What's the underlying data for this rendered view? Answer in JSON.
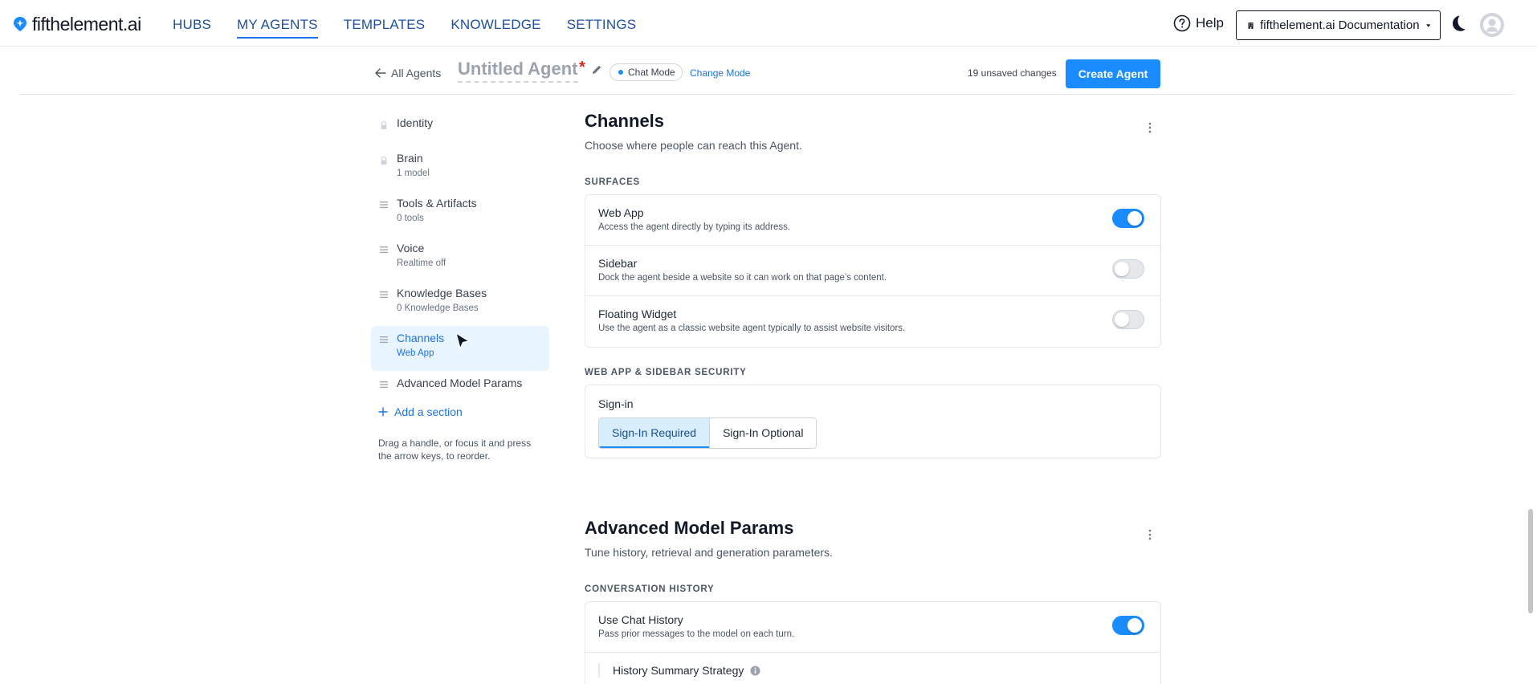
{
  "nav": {
    "brand": "fifthelement.ai",
    "links": [
      "HUBS",
      "MY AGENTS",
      "TEMPLATES",
      "KNOWLEDGE",
      "SETTINGS"
    ],
    "active_link": "MY AGENTS",
    "help": "Help",
    "org": "fifthelement.ai Documentation"
  },
  "header": {
    "back": "All Agents",
    "agent_name": "Untitled Agent",
    "required_marker": "*",
    "mode": "Chat Mode",
    "change_mode": "Change Mode",
    "unsaved": "19 unsaved changes",
    "create": "Create Agent"
  },
  "sections": {
    "items": [
      {
        "label": "Identity",
        "sub": "",
        "locked": true
      },
      {
        "label": "Brain",
        "sub": "1 model",
        "locked": true
      },
      {
        "label": "Tools & Artifacts",
        "sub": "0 tools",
        "locked": false
      },
      {
        "label": "Voice",
        "sub": "Realtime off",
        "locked": false
      },
      {
        "label": "Knowledge Bases",
        "sub": "0 Knowledge Bases",
        "locked": false
      },
      {
        "label": "Channels",
        "sub": "Web App",
        "locked": false,
        "active": true
      },
      {
        "label": "Advanced Model Params",
        "sub": "",
        "locked": false
      }
    ],
    "add": "Add a section",
    "hint": "Drag a handle, or focus it and press the arrow keys, to reorder."
  },
  "channels": {
    "title": "Channels",
    "desc": "Choose where people can reach this Agent.",
    "surfaces_label": "SURFACES",
    "surfaces": [
      {
        "title": "Web App",
        "desc": "Access the agent directly by typing its address.",
        "on": true
      },
      {
        "title": "Sidebar",
        "desc": "Dock the agent beside a website so it can work on that page’s content.",
        "on": false
      },
      {
        "title": "Floating Widget",
        "desc": "Use the agent as a classic website agent typically to assist website visitors.",
        "on": false
      }
    ],
    "security_label": "WEB APP & SIDEBAR SECURITY",
    "signin_label": "Sign-in",
    "signin_options": [
      "Sign-In Required",
      "Sign-In Optional"
    ],
    "signin_selected": "Sign-In Required"
  },
  "advanced": {
    "title": "Advanced Model Params",
    "desc": "Tune history, retrieval and generation parameters.",
    "history_label": "CONVERSATION HISTORY",
    "use_history": {
      "title": "Use Chat History",
      "desc": "Pass prior messages to the model on each turn.",
      "on": true
    },
    "summary_strategy": "History Summary Strategy"
  },
  "colors": {
    "accent": "#1a8cff",
    "link": "#1a73e8",
    "nav_link": "#1e4fa0",
    "required": "#dc2626"
  }
}
